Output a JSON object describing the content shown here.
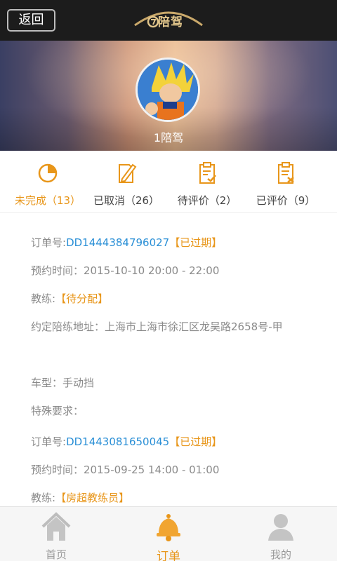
{
  "header": {
    "back_label": "返回",
    "logo_text": "陪驾"
  },
  "profile": {
    "name": "1陪驾"
  },
  "stats": [
    {
      "label": "未完成（13）",
      "icon": "pie-chart-icon"
    },
    {
      "label": "已取消（26）",
      "icon": "edit-document-icon"
    },
    {
      "label": "待评价（2）",
      "icon": "clipboard-check-icon"
    },
    {
      "label": "已评价（9）",
      "icon": "clipboard-done-icon"
    }
  ],
  "orders": [
    {
      "order_label": "订单号:",
      "order_id": "DD1444384796027",
      "status": "【已过期】",
      "time_label": "预约时间：",
      "time": "2015-10-10 20:00 - 22:00",
      "coach_label": "教练:",
      "coach": "【待分配】",
      "address_label": "约定陪练地址：",
      "address": "上海市上海市徐汇区龙吴路2658号-甲",
      "car_label": "车型：",
      "car": "手动挡",
      "special_label": "特殊要求：",
      "special": ""
    },
    {
      "order_label": "订单号:",
      "order_id": "DD1443081650045",
      "status": "【已过期】",
      "time_label": "预约时间：",
      "time": "2015-09-25 14:00 - 01:00",
      "coach_label": "教练:",
      "coach": "【房超教练员】"
    }
  ],
  "tabbar": {
    "items": [
      {
        "label": "首页",
        "icon": "home-icon"
      },
      {
        "label": "订单",
        "icon": "bell-icon"
      },
      {
        "label": "我的",
        "icon": "user-icon"
      }
    ]
  },
  "colors": {
    "accent": "#e8961a",
    "link": "#2a8fd6",
    "topbar": "#1c1c1c"
  }
}
